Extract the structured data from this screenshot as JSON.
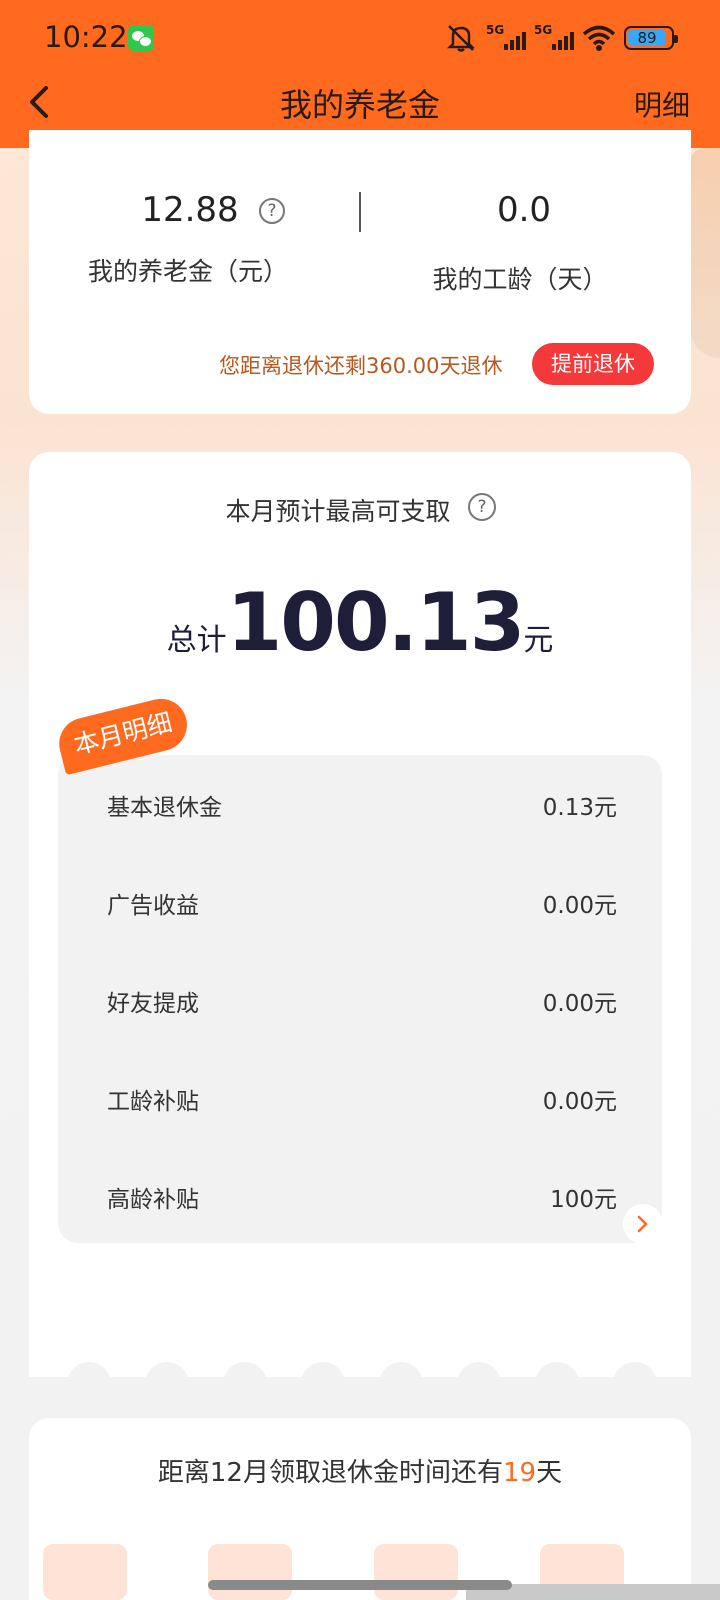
{
  "status_bar": {
    "time": "10:22",
    "battery": "89",
    "network": "5G"
  },
  "nav": {
    "title": "我的养老金",
    "detail_link": "明细"
  },
  "summary": {
    "pension_value": "12.88",
    "pension_label": "我的养老金（元）",
    "seniority_value": "0.0",
    "seniority_label": "我的工龄（天）",
    "retire_notice": "您距离退休还剩360.00天退休",
    "early_retire_button": "提前退休"
  },
  "monthly": {
    "title": "本月预计最高可支取",
    "total_prefix": "总计",
    "total_amount": "100.13",
    "total_unit": "元",
    "tag": "本月明细",
    "items": [
      {
        "label": "基本退休金",
        "value": "0.13元"
      },
      {
        "label": "广告收益",
        "value": "0.00元"
      },
      {
        "label": "好友提成",
        "value": "0.00元"
      },
      {
        "label": "工龄补贴",
        "value": "0.00元"
      },
      {
        "label": "高龄补贴",
        "value": "100元"
      }
    ]
  },
  "countdown": {
    "text_before": "距离12月领取退休金时间还有",
    "days": "19",
    "text_after": "天"
  },
  "colors": {
    "accent": "#ff6a1f",
    "button_red": "#f5383a",
    "text_brown": "#b8581e"
  }
}
